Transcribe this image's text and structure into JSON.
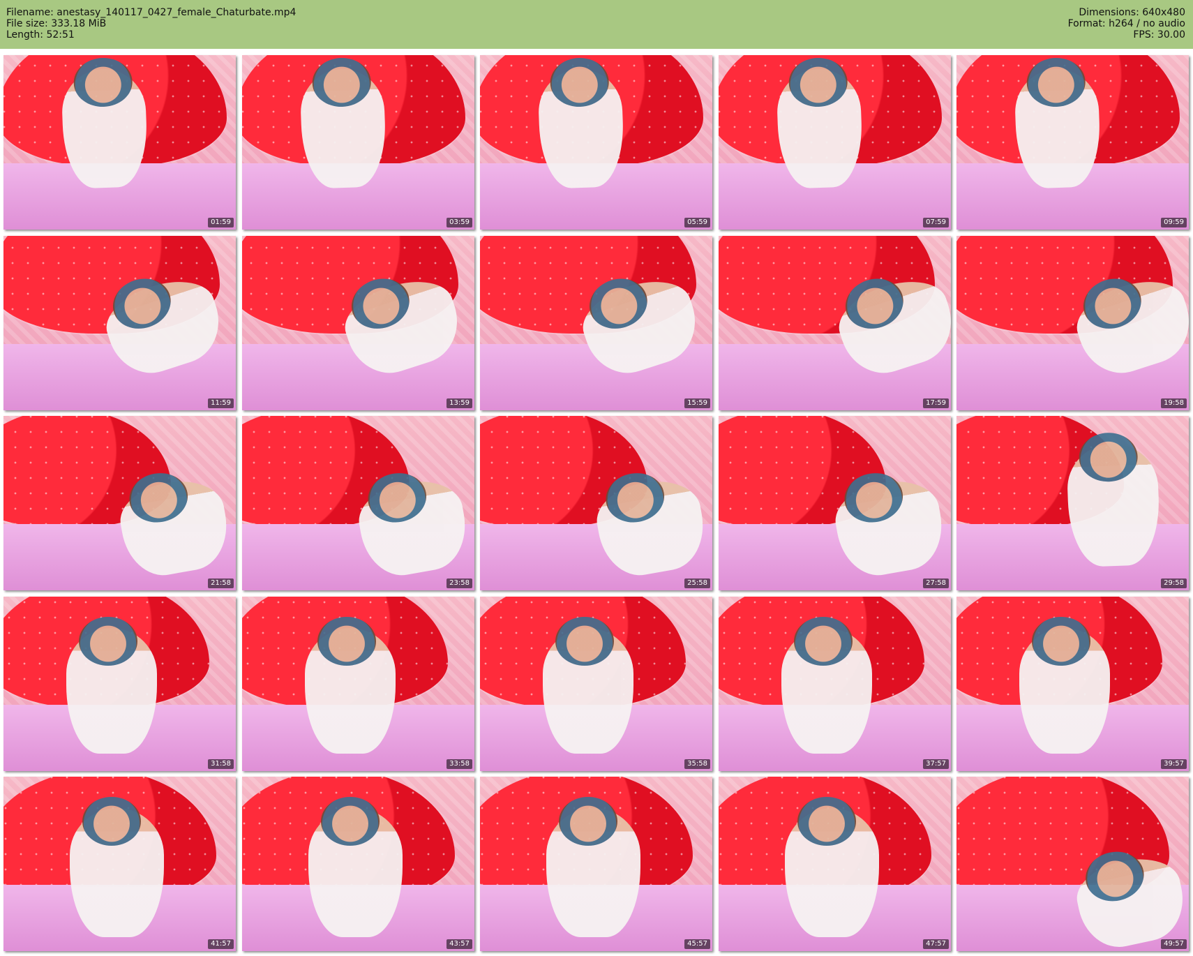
{
  "header": {
    "left": {
      "filename": "Filename: anestasy_140117_0427_female_Chaturbate.mp4",
      "filesize": "File size: 333.18 MiB",
      "length": "Length: 52:51"
    },
    "right": {
      "dimensions": "Dimensions: 640x480",
      "format": "Format: h264 / no audio",
      "fps": "FPS: 30.00"
    }
  },
  "thumbnails": [
    {
      "time": "01:59"
    },
    {
      "time": "03:59"
    },
    {
      "time": "05:59"
    },
    {
      "time": "07:59"
    },
    {
      "time": "09:59"
    },
    {
      "time": "11:59"
    },
    {
      "time": "13:59"
    },
    {
      "time": "15:59"
    },
    {
      "time": "17:59"
    },
    {
      "time": "19:58"
    },
    {
      "time": "21:58"
    },
    {
      "time": "23:58"
    },
    {
      "time": "25:58"
    },
    {
      "time": "27:58"
    },
    {
      "time": "29:58"
    },
    {
      "time": "31:58"
    },
    {
      "time": "33:58"
    },
    {
      "time": "35:58"
    },
    {
      "time": "37:57"
    },
    {
      "time": "39:57"
    },
    {
      "time": "41:57"
    },
    {
      "time": "43:57"
    },
    {
      "time": "45:57"
    },
    {
      "time": "47:57"
    },
    {
      "time": "49:57"
    }
  ]
}
